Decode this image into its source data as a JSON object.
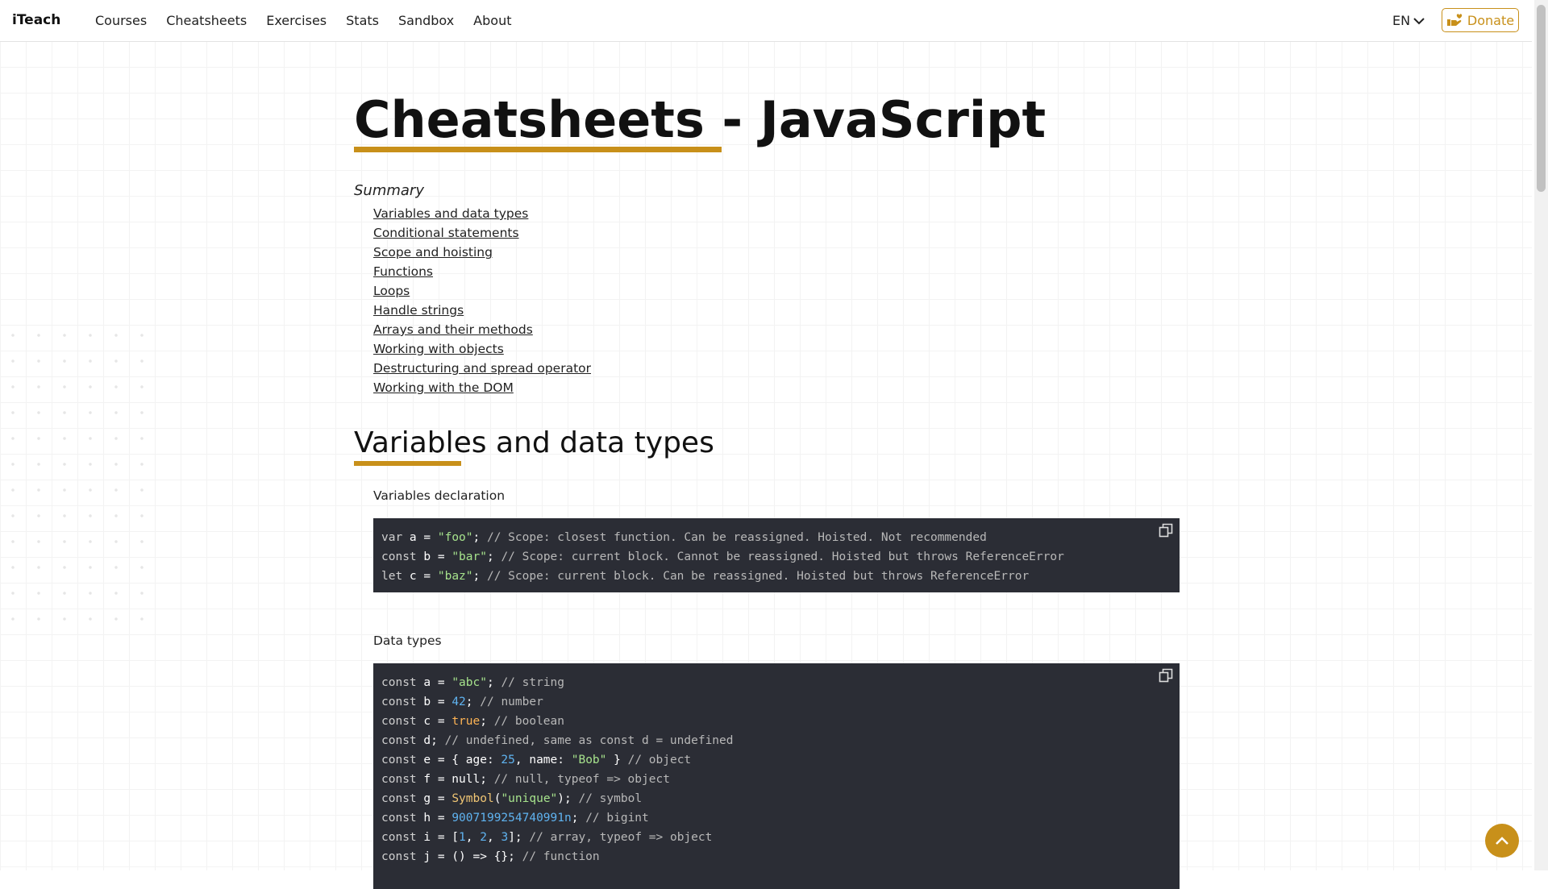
{
  "navbar": {
    "brand": "iTeach",
    "links": [
      "Courses",
      "Cheatsheets",
      "Exercises",
      "Stats",
      "Sandbox",
      "About"
    ],
    "language": "EN",
    "donate_label": "Donate"
  },
  "page": {
    "title": "Cheatsheets - JavaScript",
    "summary_label": "Summary",
    "toc": [
      "Variables and data types",
      "Conditional statements",
      "Scope and hoisting",
      "Functions",
      "Loops",
      "Handle strings",
      "Arrays and their methods",
      "Working with objects",
      "Destructuring and spread operator",
      "Working with the DOM"
    ]
  },
  "section": {
    "title": "Variables and data types",
    "blocks": [
      {
        "label": "Variables declaration",
        "lines": [
          "var a = \"foo\"; // Scope: closest function. Can be reassigned. Hoisted. Not recommended",
          "const b = \"bar\"; // Scope: current block. Cannot be reassigned. Hoisted but throws ReferenceError",
          "let c = \"baz\"; // Scope: current block. Can be reassigned. Hoisted but throws ReferenceError"
        ]
      },
      {
        "label": "Data types",
        "lines": [
          "const a = \"abc\"; // string",
          "const b = 42; // number",
          "const c = true; // boolean",
          "const d; // undefined, same as const d = undefined",
          "const e = { age: 25, name: \"Bob\" } // object",
          "const f = null; // null, typeof => object",
          "const g = Symbol(\"unique\"); // symbol",
          "const h = 9007199254740991n; // bigint",
          "const i = [1, 2, 3]; // array, typeof => object",
          "const j = () => {}; // function"
        ]
      }
    ]
  },
  "colors": {
    "accent": "#c8901a",
    "code_bg": "#2b2d35",
    "string": "#a6e28c",
    "number": "#5fb3f0",
    "boolean": "#ffb454"
  },
  "icons": [
    "chevron-down-icon",
    "donate-hand-icon",
    "copy-icon",
    "arrow-up-icon"
  ]
}
